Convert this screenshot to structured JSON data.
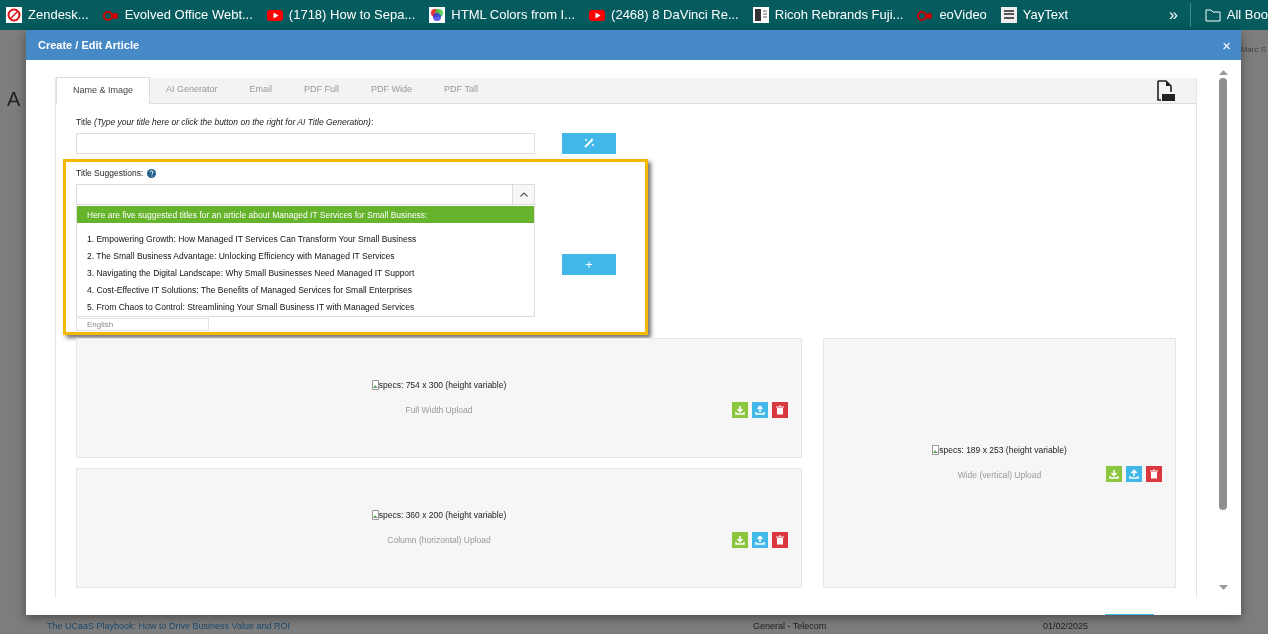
{
  "bookmarks": [
    {
      "label": "Zendesk...",
      "kind": "ring"
    },
    {
      "label": "Evolved Office Webt...",
      "kind": "eo"
    },
    {
      "label": "(1718) How to Sepa...",
      "kind": "play"
    },
    {
      "label": "HTML Colors from I...",
      "kind": "wheel"
    },
    {
      "label": "(2468) 8 DaVinci Re...",
      "kind": "play"
    },
    {
      "label": "Ricoh Rebrands Fuji...",
      "kind": "doc"
    },
    {
      "label": "eoVideo",
      "kind": "eo"
    },
    {
      "label": "YayText",
      "kind": "tile"
    }
  ],
  "bookmarks_more": "»",
  "all_bookmarks": "All Boo",
  "background": {
    "heading": "A",
    "user": "Marc S",
    "row": [
      "The UCaaS Playbook: How to Drive Business Value and ROI",
      "General - Telecom",
      "01/02/2025"
    ]
  },
  "modal": {
    "title": "Create / Edit Article",
    "close": "×"
  },
  "tabs": [
    {
      "label": "Name & Image",
      "selected": true
    },
    {
      "label": "AI Generator",
      "selected": false
    },
    {
      "label": "Email",
      "selected": false
    },
    {
      "label": "PDF Full",
      "selected": false
    },
    {
      "label": "PDF Wide",
      "selected": false
    },
    {
      "label": "PDF Tall",
      "selected": false
    }
  ],
  "title_field": {
    "label": "Title *(Type your title here or click the button on the right for AI Title Generation)*:"
  },
  "suggestions": {
    "label": "Title Suggestions:",
    "expanded": true,
    "intro": "Here are five suggested titles for an article about Managed IT Services for Small Business:",
    "items": [
      "1. Empowering Growth: How Managed IT Services Can Transform Your Small Business",
      "2. The Small Business Advantage: Unlocking Efficiency with Managed IT Services",
      "3. Navigating the Digital Landscape: Why Small Businesses Need Managed IT Support",
      "4. Cost-Effective IT Solutions: The Benefits of Managed Services for Small Enterprises",
      "5. From Chaos to Control: Streamlining Your Small Business IT with Managed Services"
    ]
  },
  "add_button": "+",
  "language": {
    "value": "English"
  },
  "uploads": [
    {
      "spec": "specs: 754 x 300 (height variable)",
      "label": "Full Width Upload"
    },
    {
      "spec": "specs: 360 x 200 (height variable)",
      "label": "Column (horizontal) Upload"
    },
    {
      "spec": "specs: 189 x 253 (height variable)",
      "label": "Wide (vertical) Upload"
    }
  ]
}
